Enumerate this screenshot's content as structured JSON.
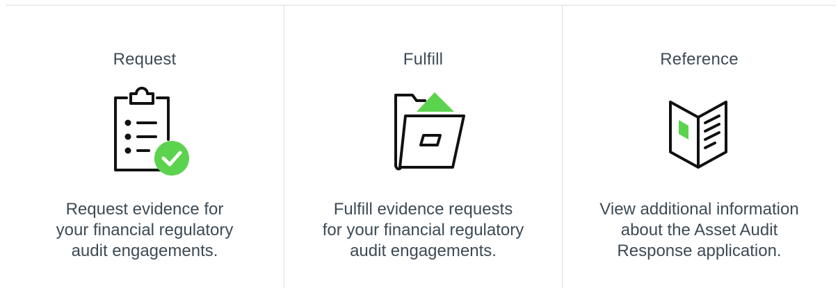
{
  "cards": [
    {
      "title": "Request",
      "icon": "clipboard-check-icon",
      "description_lines": [
        "Request evidence for",
        "your financial regulatory",
        "audit engagements."
      ]
    },
    {
      "title": "Fulfill",
      "icon": "folder-upload-icon",
      "description_lines": [
        "Fulfill evidence requests",
        "for your financial regulatory",
        "audit engagements."
      ]
    },
    {
      "title": "Reference",
      "icon": "open-book-icon",
      "description_lines": [
        "View additional information",
        "about the Asset Audit",
        "Response application."
      ]
    }
  ],
  "colors": {
    "accent_green": "#5cd34e",
    "text": "#3d4a55",
    "divider": "#dcdcdc",
    "icon_stroke": "#111111"
  }
}
